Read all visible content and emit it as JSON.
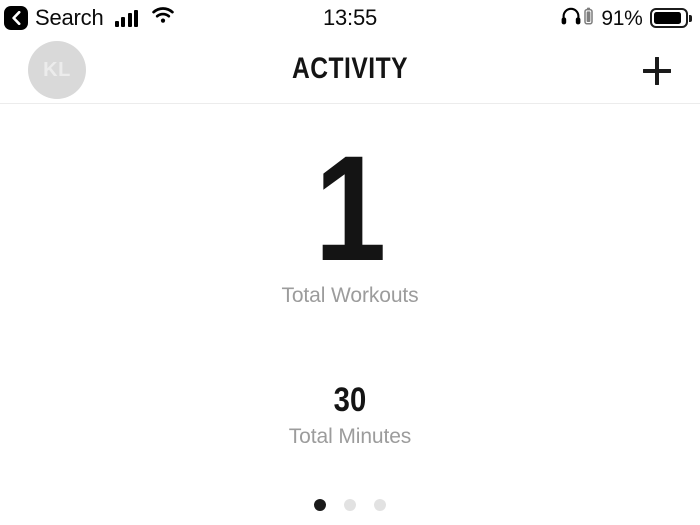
{
  "status_bar": {
    "back_icon": "chevron-left-icon",
    "back_label": "Search",
    "signal_icon": "cellular-signal-icon",
    "wifi_icon": "wifi-icon",
    "time": "13:55",
    "headphones_icon": "headphones-icon",
    "headphones_battery_icon": "small-battery-icon",
    "battery_percent": "91%",
    "battery_icon": "battery-full-icon",
    "battery_level": 92
  },
  "nav_bar": {
    "avatar_initials": "KL",
    "avatar_color": "#d9d9d9",
    "title": "ACTIVITY",
    "add_icon": "plus-icon"
  },
  "content": {
    "primary_stat": {
      "value": "1",
      "label": "Total Workouts"
    },
    "secondary_stat": {
      "value": "30",
      "label": "Total Minutes"
    }
  },
  "page_indicator": {
    "total": 3,
    "active_index": 0,
    "active_color": "#1a1a1a",
    "inactive_color": "#e2e2e2"
  },
  "theme": {
    "background": "#ffffff",
    "text_primary": "#141414",
    "text_muted": "#9c9c9c",
    "divider": "#ececec"
  }
}
